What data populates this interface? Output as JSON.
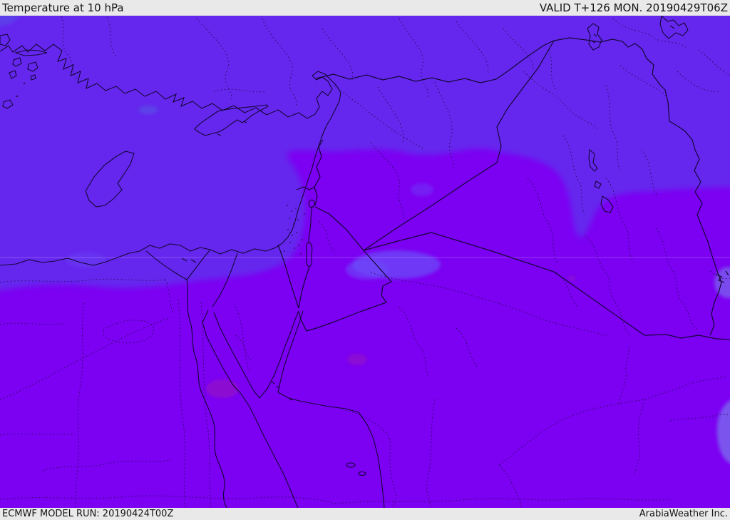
{
  "header": {
    "title": "Temperature at 10 hPa",
    "valid_label": "VALID T+126 MON. 20190429T06Z"
  },
  "footer": {
    "model_run": "ECMWF MODEL RUN: 20190424T00Z",
    "attribution": "ArabiaWeather Inc."
  },
  "map": {
    "colors": {
      "cold_base": "#6527ee",
      "warm_region": "#7b02f2",
      "light_patch": "#5b45e8",
      "light_patch_saudi": "#6b4bf7",
      "light_patch_edge": "#7a63ec",
      "magenta_patch": "#9113c9",
      "bar_bg": "#e9e9e9",
      "coast_stroke": "#140636",
      "admin_stroke": "#1f0c4a",
      "gridline": "rgba(255,255,255,0.22)"
    }
  }
}
